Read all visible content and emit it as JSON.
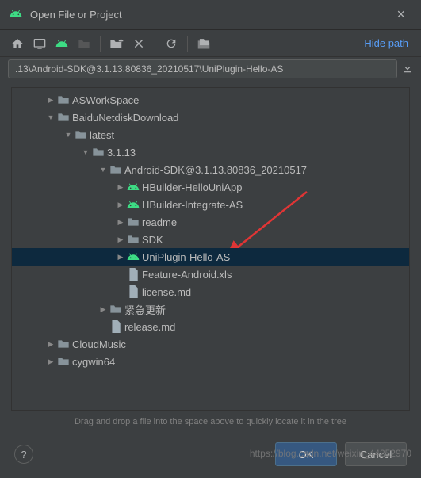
{
  "dialog": {
    "title": "Open File or Project",
    "hide_path": "Hide path",
    "path": ".13\\Android-SDK@3.1.13.80836_20210517\\UniPlugin-Hello-AS",
    "hint": "Drag and drop a file into the space above to quickly locate it in the tree",
    "ok": "OK",
    "cancel": "Cancel",
    "help": "?",
    "close": "×",
    "watermark": "https://blog.csdn.net/weixin_44252970"
  },
  "tree": [
    {
      "depth": 1,
      "tw": ">",
      "icon": "folder",
      "label": "ASWorkSpace",
      "sel": false
    },
    {
      "depth": 1,
      "tw": "v",
      "icon": "folder",
      "label": "BaiduNetdiskDownload",
      "sel": false
    },
    {
      "depth": 2,
      "tw": "v",
      "icon": "folder",
      "label": "latest",
      "sel": false
    },
    {
      "depth": 3,
      "tw": "v",
      "icon": "folder",
      "label": "3.1.13",
      "sel": false
    },
    {
      "depth": 4,
      "tw": "v",
      "icon": "folder",
      "label": "Android-SDK@3.1.13.80836_20210517",
      "sel": false
    },
    {
      "depth": 5,
      "tw": ">",
      "icon": "android",
      "label": "HBuilder-HelloUniApp",
      "sel": false
    },
    {
      "depth": 5,
      "tw": ">",
      "icon": "android",
      "label": "HBuilder-Integrate-AS",
      "sel": false
    },
    {
      "depth": 5,
      "tw": ">",
      "icon": "folder",
      "label": "readme",
      "sel": false
    },
    {
      "depth": 5,
      "tw": ">",
      "icon": "folder",
      "label": "SDK",
      "sel": false
    },
    {
      "depth": 5,
      "tw": ">",
      "icon": "android",
      "label": "UniPlugin-Hello-AS",
      "sel": true
    },
    {
      "depth": 5,
      "tw": "",
      "icon": "file",
      "label": "Feature-Android.xls",
      "sel": false
    },
    {
      "depth": 5,
      "tw": "",
      "icon": "file",
      "label": "license.md",
      "sel": false
    },
    {
      "depth": 4,
      "tw": ">",
      "icon": "folder",
      "label": "紧急更新",
      "sel": false
    },
    {
      "depth": 4,
      "tw": "",
      "icon": "file",
      "label": "release.md",
      "sel": false
    },
    {
      "depth": 1,
      "tw": ">",
      "icon": "folder",
      "label": "CloudMusic",
      "sel": false
    },
    {
      "depth": 1,
      "tw": ">",
      "icon": "folder",
      "label": "cygwin64",
      "sel": false
    }
  ]
}
